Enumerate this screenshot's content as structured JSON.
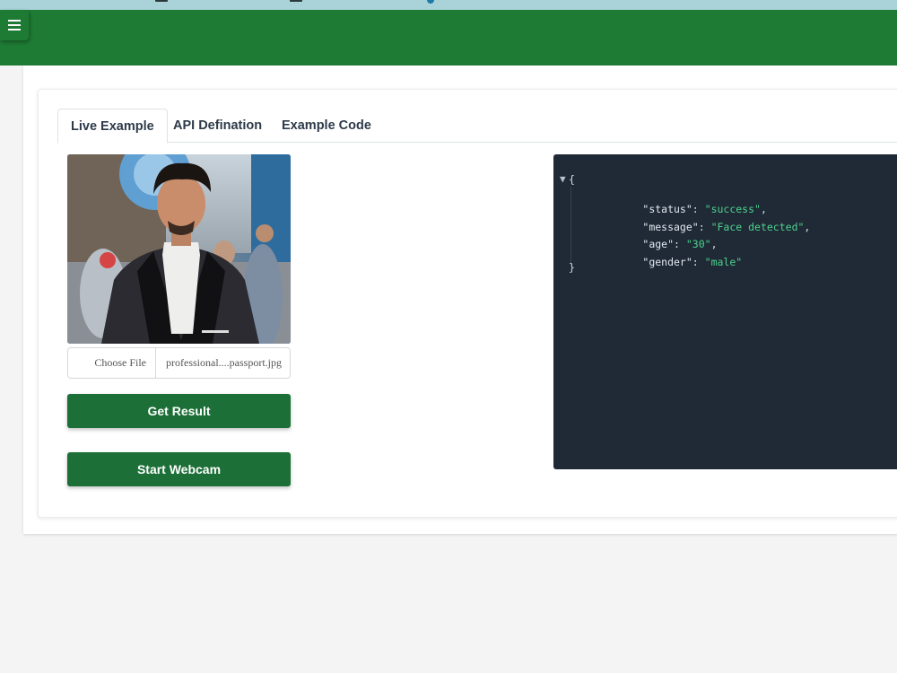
{
  "header": {
    "menu_icon": "hamburger-menu-icon",
    "brand_color": "#1e7b34"
  },
  "tabs": [
    {
      "label": "Live Example",
      "active": true
    },
    {
      "label": "API Defination",
      "active": false
    },
    {
      "label": "Example Code",
      "active": false
    }
  ],
  "file_input": {
    "button_label": "Choose File",
    "file_name": "professional....passport.jpg"
  },
  "buttons": {
    "get_result": "Get Result",
    "start_webcam": "Start Webcam",
    "color": "#1b6f37"
  },
  "response": {
    "open_brace": "{",
    "close_brace": "}",
    "fields": [
      {
        "key": "\"status\"",
        "value": "\"success\"",
        "sep": ","
      },
      {
        "key": "\"message\"",
        "value": "\"Face detected\"",
        "sep": ","
      },
      {
        "key": "\"age\"",
        "value": "\"30\"",
        "sep": ","
      },
      {
        "key": "\"gender\"",
        "value": "\"male\"",
        "sep": ""
      }
    ],
    "toggle_glyph": "▼"
  }
}
